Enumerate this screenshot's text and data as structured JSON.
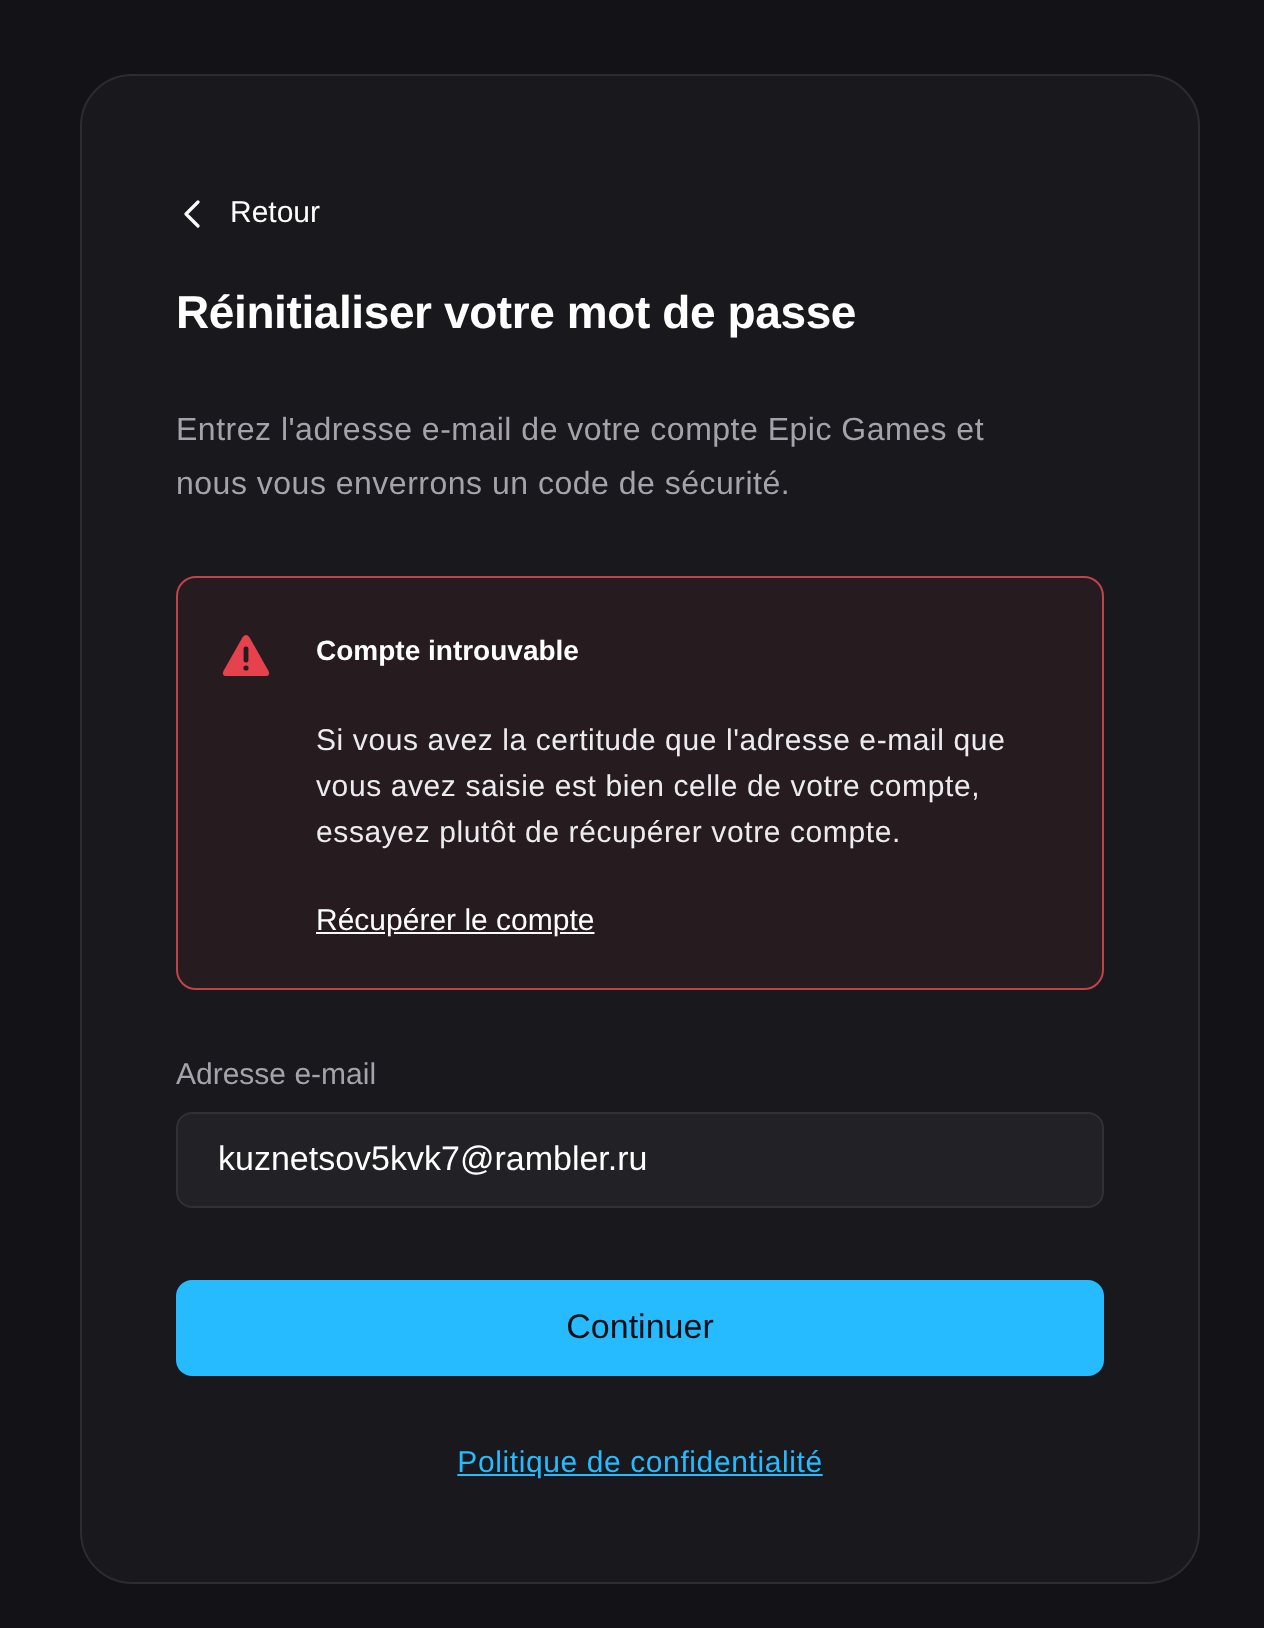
{
  "back_link": {
    "label": "Retour"
  },
  "title": "Réinitialiser votre mot de passe",
  "description": "Entrez l'adresse e-mail de votre compte Epic Games et nous vous enverrons un code de sécurité.",
  "alert": {
    "kind": "error",
    "title": "Compte introuvable",
    "message": "Si vous avez la certitude que l'adresse e-mail que vous avez saisie est bien celle de votre compte, essayez plutôt de récupérer votre compte.",
    "link": "Récupérer le compte"
  },
  "email_field": {
    "label": "Adresse e-mail",
    "value": "kuznetsov5kvk7@rambler.ru"
  },
  "primary_button": {
    "label": "Continuer"
  },
  "footer_link": {
    "label": "Politique de confidentialité"
  }
}
